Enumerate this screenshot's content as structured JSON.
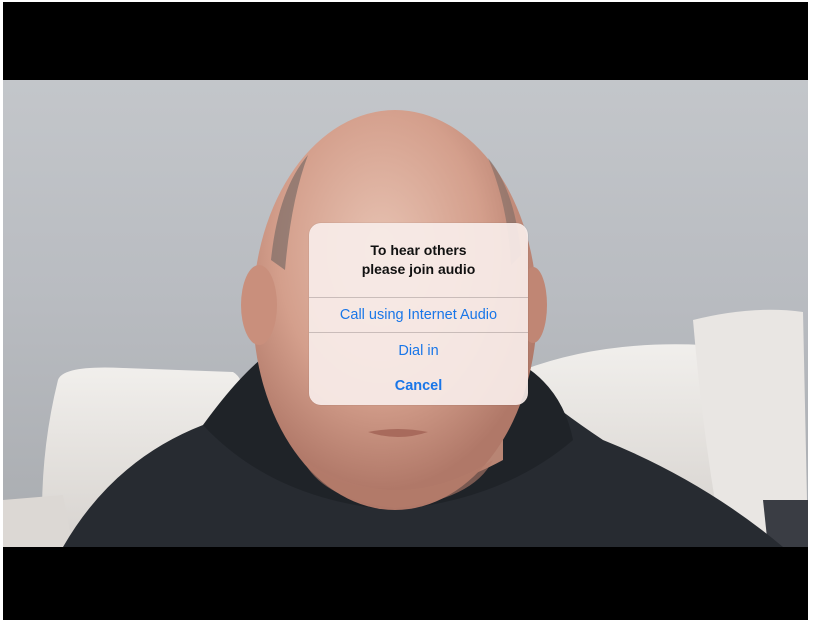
{
  "alert": {
    "title_line1": "To hear others",
    "title_line2": "please join audio",
    "actions": [
      {
        "label": "Call using Internet Audio",
        "style": "default"
      },
      {
        "label": "Dial in",
        "style": "default"
      },
      {
        "label": "Cancel",
        "style": "cancel"
      }
    ],
    "action_color": "#1976e8"
  },
  "video": {
    "background": "#000000"
  }
}
